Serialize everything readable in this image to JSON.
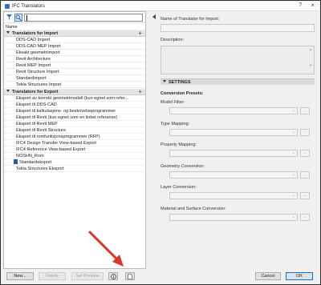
{
  "window": {
    "title": "IFC Translators",
    "help_icon": "?",
    "close_icon": "×"
  },
  "search": {
    "value": ""
  },
  "list": {
    "header": "Name",
    "import_group": {
      "label": "Translators for Import",
      "items": [
        "DDS-CAD Import",
        "DDS-CAD MEP Import",
        "Eksakt geometriimport",
        "Revit Architecture",
        "Revit MEP Import",
        "Revit Structure Import",
        "Standardimport",
        "Tekla Structures Import"
      ]
    },
    "export_group": {
      "label": "Translators for Export",
      "items": [
        "Eksport av korrekt geometrimodell (kun egnet som refer...",
        "Eksport til DDS-CAD",
        "Eksport til kalkulasjons- og beskrivelseprogrammer",
        "Eksport til Revit (kun egnet som en linket referanse)",
        "Eksport til Revit MEP",
        "Eksport til Revit Structure",
        "Eksport til romfunksjonsprogrammer (RFP)",
        "IFC4 Design Transfer View-based Export",
        "IFC4 Reference View-based Export",
        "NOSHN_Rom",
        "Standardeksport",
        "Tekla Structures Eksport"
      ]
    }
  },
  "buttons": {
    "new": "New...",
    "delete": "Delete",
    "set_preview": "Set Preview",
    "cancel": "Cancel",
    "ok": "OK"
  },
  "right": {
    "name_label": "Name of Translator for Import:",
    "description_label": "Description:",
    "settings_label": "SETTINGS",
    "conversion_presets": "Conversion Presets:",
    "presets": [
      "Model Filter:",
      "Type Mapping:",
      "Property Mapping:",
      "Geometry Conversion:",
      "Layer Conversion:",
      "Material and Surface Conversion:"
    ],
    "dots": "..."
  },
  "colors": {
    "accent": "#3b6fb6",
    "arrow": "#e0332b"
  },
  "icons": {
    "filter": "filter-icon",
    "search": "search-icon",
    "info": "info-icon",
    "document": "document-icon"
  }
}
